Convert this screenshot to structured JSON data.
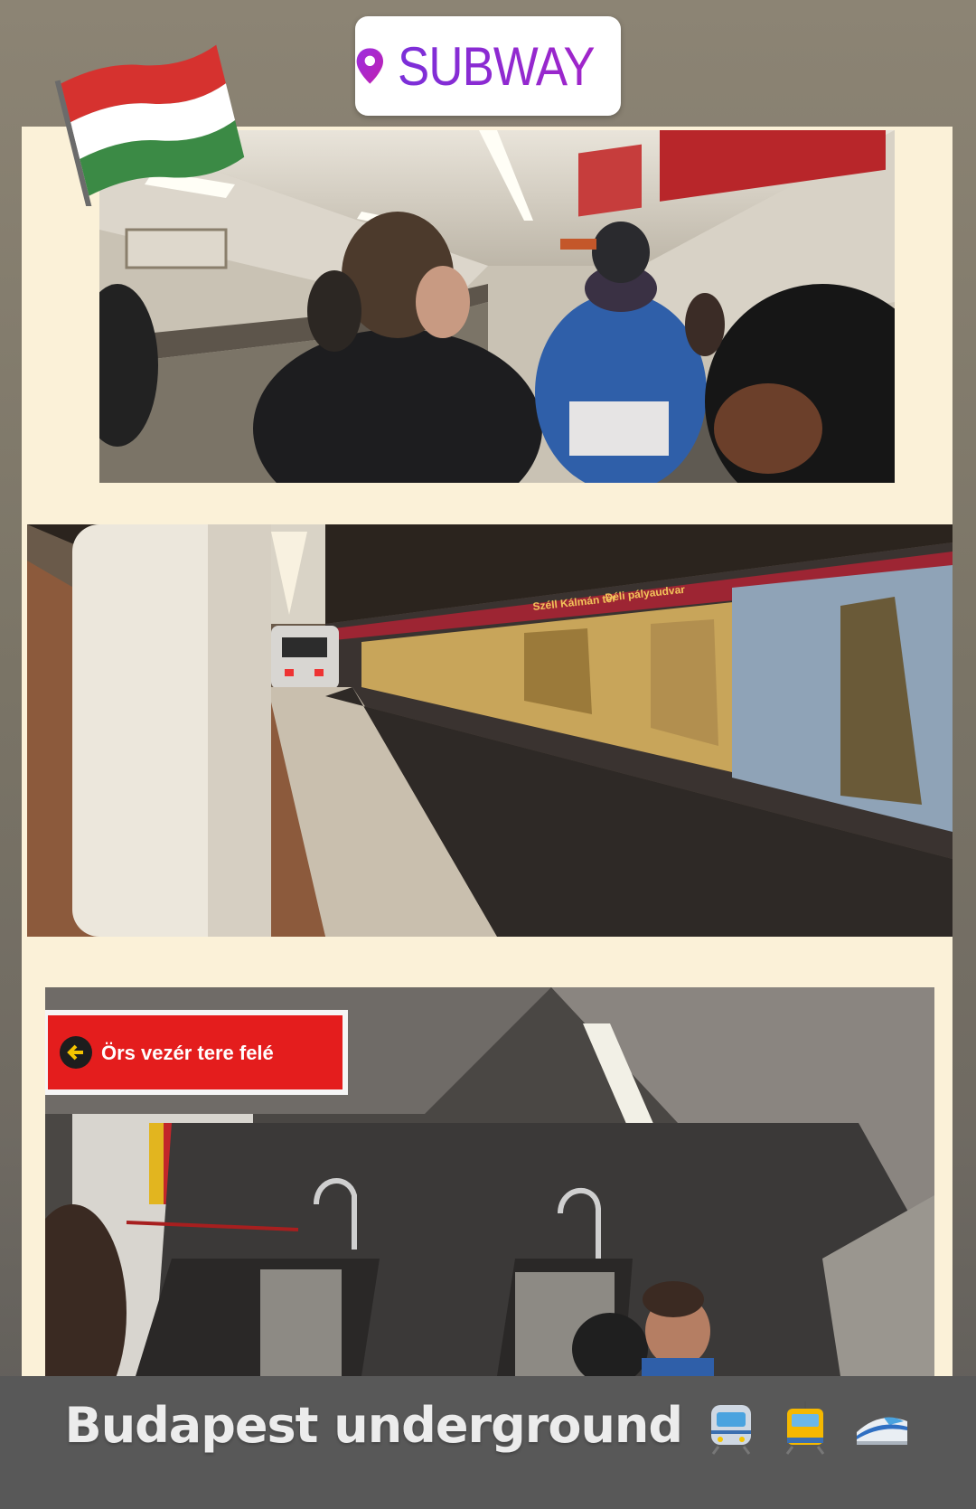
{
  "location_sticker": {
    "icon": "map-pin-icon",
    "label": "SUBWAY",
    "color": "#7b2fd9"
  },
  "flag": {
    "icon": "hungary-flag-icon",
    "colors": [
      "#d6322f",
      "#ffffff",
      "#3b8a45"
    ]
  },
  "photos": {
    "escalator_descent": {
      "description_icon": "escalator-photo"
    },
    "platform": {
      "station_board": [
        "Széll Kálmán tér",
        "Déli pályaudvar"
      ]
    },
    "lower_hall": {
      "direction_sign": "Örs vezér tere felé",
      "sign_color": "#e41d1d"
    }
  },
  "caption": {
    "text": "Budapest underground",
    "emoji_icons": [
      "metro-train-icon",
      "tram-icon",
      "bullet-train-icon"
    ]
  }
}
